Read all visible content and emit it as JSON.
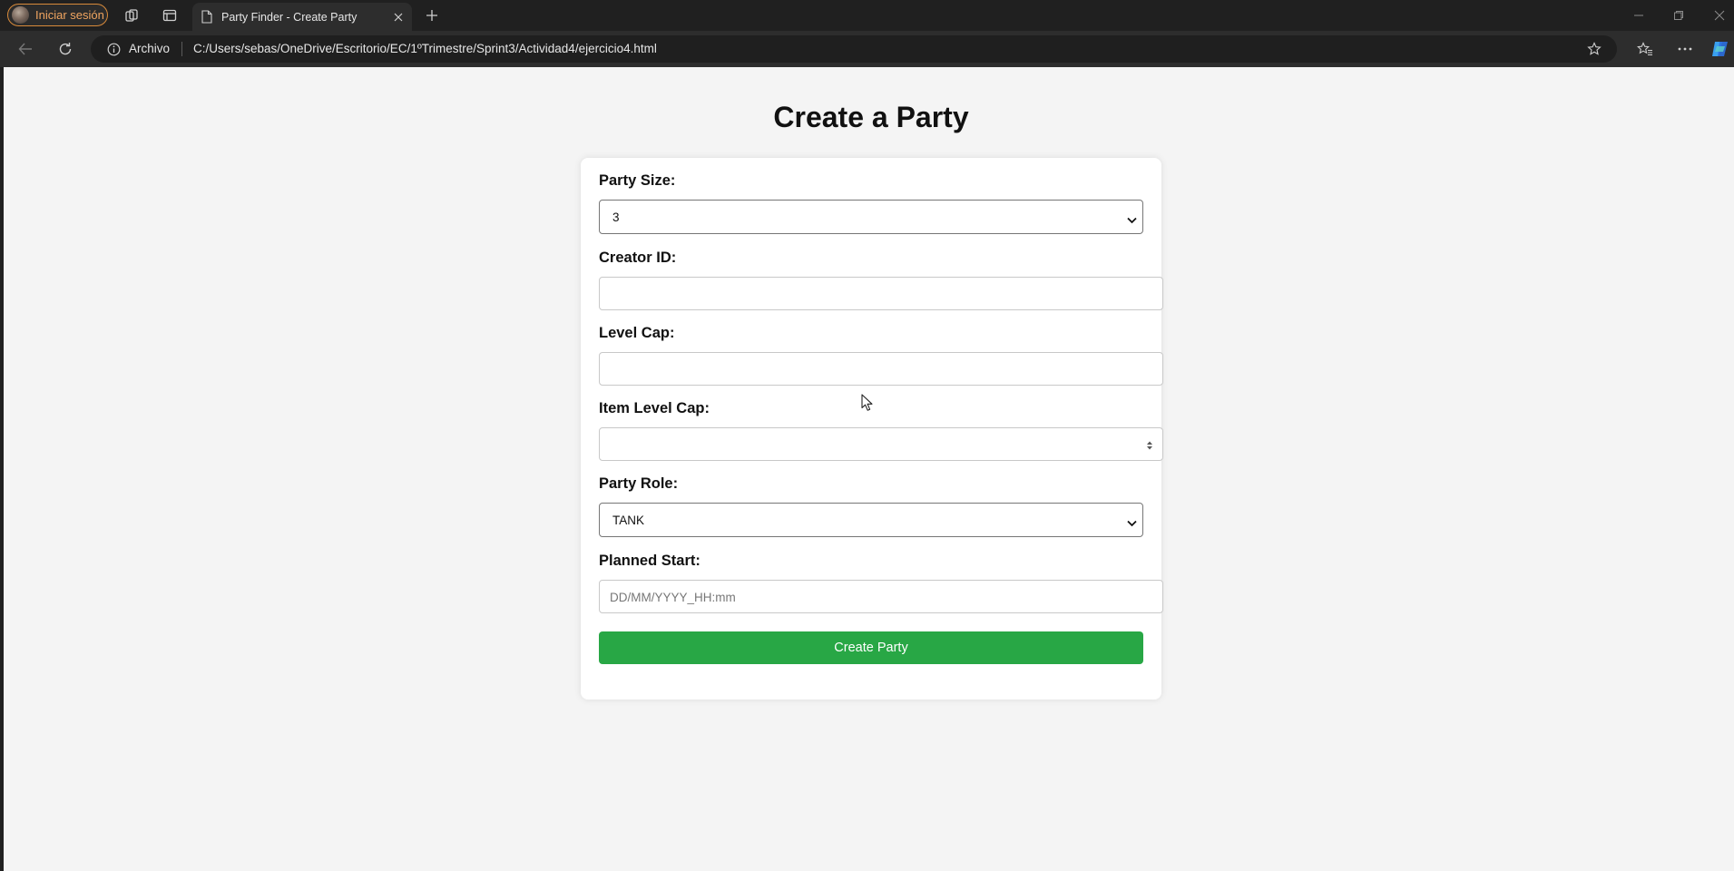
{
  "browser": {
    "profile_label": "Iniciar sesión",
    "tab_title": "Party Finder - Create Party",
    "address_scheme_label": "Archivo",
    "url": "C:/Users/sebas/OneDrive/Escritorio/EC/1ºTrimestre/Sprint3/Actividad4/ejercicio4.html"
  },
  "page": {
    "title": "Create a Party",
    "form": {
      "party_size_label": "Party Size:",
      "party_size_value": "3",
      "creator_id_label": "Creator ID:",
      "creator_id_value": "",
      "level_cap_label": "Level Cap:",
      "level_cap_value": "",
      "item_level_cap_label": "Item Level Cap:",
      "item_level_cap_value": "",
      "party_role_label": "Party Role:",
      "party_role_value": "TANK",
      "planned_start_label": "Planned Start:",
      "planned_start_placeholder": "DD/MM/YYYY_HH:mm",
      "submit_label": "Create Party"
    }
  },
  "colors": {
    "submit_button": "#28a745",
    "page_background": "#f4f4f4",
    "browser_chrome": "#202020",
    "profile_accent": "#f0a560"
  },
  "icons": [
    "workspaces-icon",
    "tab-actions-icon",
    "page-icon",
    "close-icon",
    "new-tab-icon",
    "back-icon",
    "refresh-icon",
    "info-icon",
    "favorite-star-icon",
    "favorites-icon",
    "more-icon",
    "copilot-icon",
    "minimize-icon",
    "restore-icon",
    "window-close-icon",
    "chevron-down-icon",
    "spinner-icon",
    "mouse-cursor-icon"
  ]
}
